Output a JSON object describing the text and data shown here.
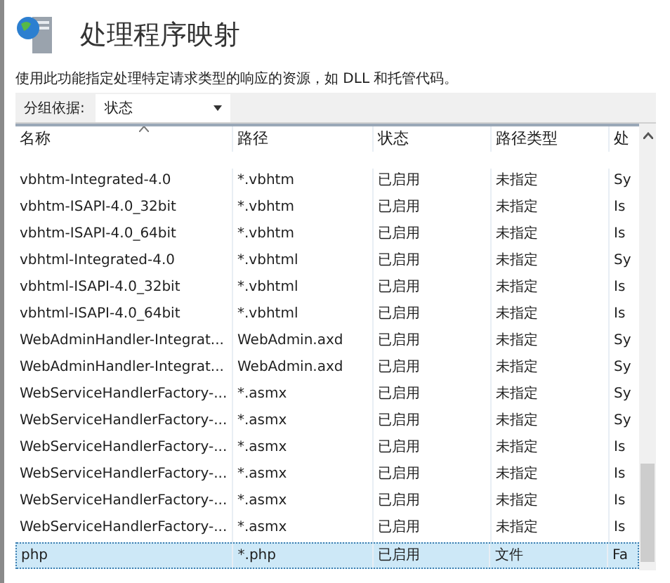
{
  "title": "处理程序映射",
  "description": "使用此功能指定处理特定请求类型的响应的资源，如 DLL 和托管代码。",
  "group_by": {
    "label": "分组依据:",
    "value": "状态"
  },
  "table": {
    "columns": [
      "名称",
      "路径",
      "状态",
      "路径类型",
      "处"
    ],
    "rows": [
      {
        "cells": [
          "vbhtm-Integrated-4.0",
          "*.vbhtm",
          "已启用",
          "未指定",
          "Sy"
        ],
        "selected": false
      },
      {
        "cells": [
          "vbhtm-ISAPI-4.0_32bit",
          "*.vbhtm",
          "已启用",
          "未指定",
          "Is"
        ],
        "selected": false
      },
      {
        "cells": [
          "vbhtm-ISAPI-4.0_64bit",
          "*.vbhtm",
          "已启用",
          "未指定",
          "Is"
        ],
        "selected": false
      },
      {
        "cells": [
          "vbhtml-Integrated-4.0",
          "*.vbhtml",
          "已启用",
          "未指定",
          "Sy"
        ],
        "selected": false
      },
      {
        "cells": [
          "vbhtml-ISAPI-4.0_32bit",
          "*.vbhtml",
          "已启用",
          "未指定",
          "Is"
        ],
        "selected": false
      },
      {
        "cells": [
          "vbhtml-ISAPI-4.0_64bit",
          "*.vbhtml",
          "已启用",
          "未指定",
          "Is"
        ],
        "selected": false
      },
      {
        "cells": [
          "WebAdminHandler-Integrat...",
          "WebAdmin.axd",
          "已启用",
          "未指定",
          "Sy"
        ],
        "selected": false
      },
      {
        "cells": [
          "WebAdminHandler-Integrat...",
          "WebAdmin.axd",
          "已启用",
          "未指定",
          "Sy"
        ],
        "selected": false
      },
      {
        "cells": [
          "WebServiceHandlerFactory-...",
          "*.asmx",
          "已启用",
          "未指定",
          "Sy"
        ],
        "selected": false
      },
      {
        "cells": [
          "WebServiceHandlerFactory-...",
          "*.asmx",
          "已启用",
          "未指定",
          "Sy"
        ],
        "selected": false
      },
      {
        "cells": [
          "WebServiceHandlerFactory-...",
          "*.asmx",
          "已启用",
          "未指定",
          "Is"
        ],
        "selected": false
      },
      {
        "cells": [
          "WebServiceHandlerFactory-...",
          "*.asmx",
          "已启用",
          "未指定",
          "Is"
        ],
        "selected": false
      },
      {
        "cells": [
          "WebServiceHandlerFactory-...",
          "*.asmx",
          "已启用",
          "未指定",
          "Is"
        ],
        "selected": false
      },
      {
        "cells": [
          "WebServiceHandlerFactory-...",
          "*.asmx",
          "已启用",
          "未指定",
          "Is"
        ],
        "selected": false
      },
      {
        "cells": [
          "php",
          "*.php",
          "已启用",
          "文件",
          "Fa"
        ],
        "selected": true
      }
    ]
  }
}
